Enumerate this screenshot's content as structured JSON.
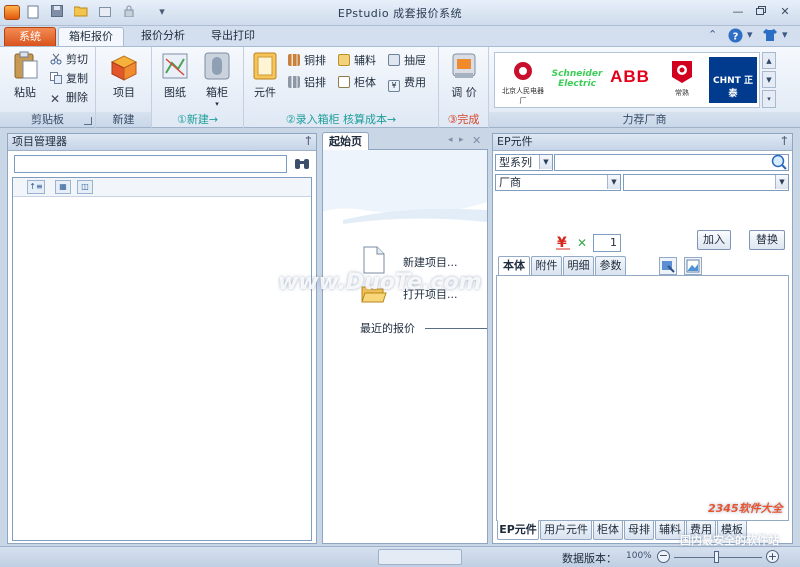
{
  "window": {
    "title": "EPstudio 成套报价系统",
    "quick_access": [
      "new-icon",
      "save-icon",
      "open-icon",
      "export-icon",
      "lock-icon",
      "dropdown-icon"
    ],
    "controls": [
      "minimize",
      "restore",
      "close"
    ]
  },
  "tabs": {
    "system": "系统",
    "items": [
      "箱柜报价",
      "报价分析",
      "导出打印"
    ],
    "active_index": 0
  },
  "ribbon": {
    "clipboard": {
      "paste": "粘贴",
      "cut": "剪切",
      "copy": "复制",
      "delete": "删除",
      "label": "剪贴板"
    },
    "new_group": {
      "project": "项目",
      "label": "新建"
    },
    "drawing": {
      "drawing": "图纸",
      "cabinet": "箱柜",
      "label": "①新建→"
    },
    "components": {
      "component": "元件",
      "copper_bar": "铜排",
      "aux": "辅料",
      "drawer": "抽屉",
      "aluminum_bar": "铝排",
      "cabinet_body": "柜体",
      "fee": "费用",
      "label": "②录入箱柜   核算成本→"
    },
    "adjust": {
      "adjust_price": "调 价",
      "label": "③完成"
    },
    "vendors": {
      "label": "力荐厂商",
      "items": [
        {
          "name": "北京人民电器厂",
          "color": "#c8102e"
        },
        {
          "name": "Schneider Electric",
          "color": "#3dcd58"
        },
        {
          "name": "ABB",
          "color": "#e2001a"
        },
        {
          "name": "常熟",
          "color": "#d2001f"
        },
        {
          "name": "CHNT 正泰",
          "color": "#003b8e"
        }
      ]
    }
  },
  "project_manager": {
    "title": "项目管理器",
    "search_value": ""
  },
  "start_page": {
    "tab": "起始页",
    "new_project": "新建项目...",
    "open_project": "打开项目...",
    "recent": "最近的报价"
  },
  "ep_panel": {
    "title": "EP元件",
    "series_label": "型系列",
    "series_value": "",
    "vendor_label": "厂商",
    "vendor_value": "",
    "quantity": "1",
    "add": "加入",
    "replace": "替换",
    "top_tabs": [
      "本体",
      "附件",
      "明细",
      "参数"
    ],
    "bottom_tabs": [
      "EP元件",
      "用户元件",
      "柜体",
      "母排",
      "辅料",
      "费用",
      "模板"
    ]
  },
  "status": {
    "data_version_label": "数据版本：",
    "zoom": "100%"
  },
  "watermarks": {
    "site": "www.DuoTe.com",
    "brand": "2345软件大全",
    "slogan": "国内最安全的软件站"
  },
  "colors": {
    "system_tab": "#e0612a",
    "flow_label": "#1d9e9a",
    "done_label": "#d6452a",
    "accent_blue": "#2a5a94"
  }
}
